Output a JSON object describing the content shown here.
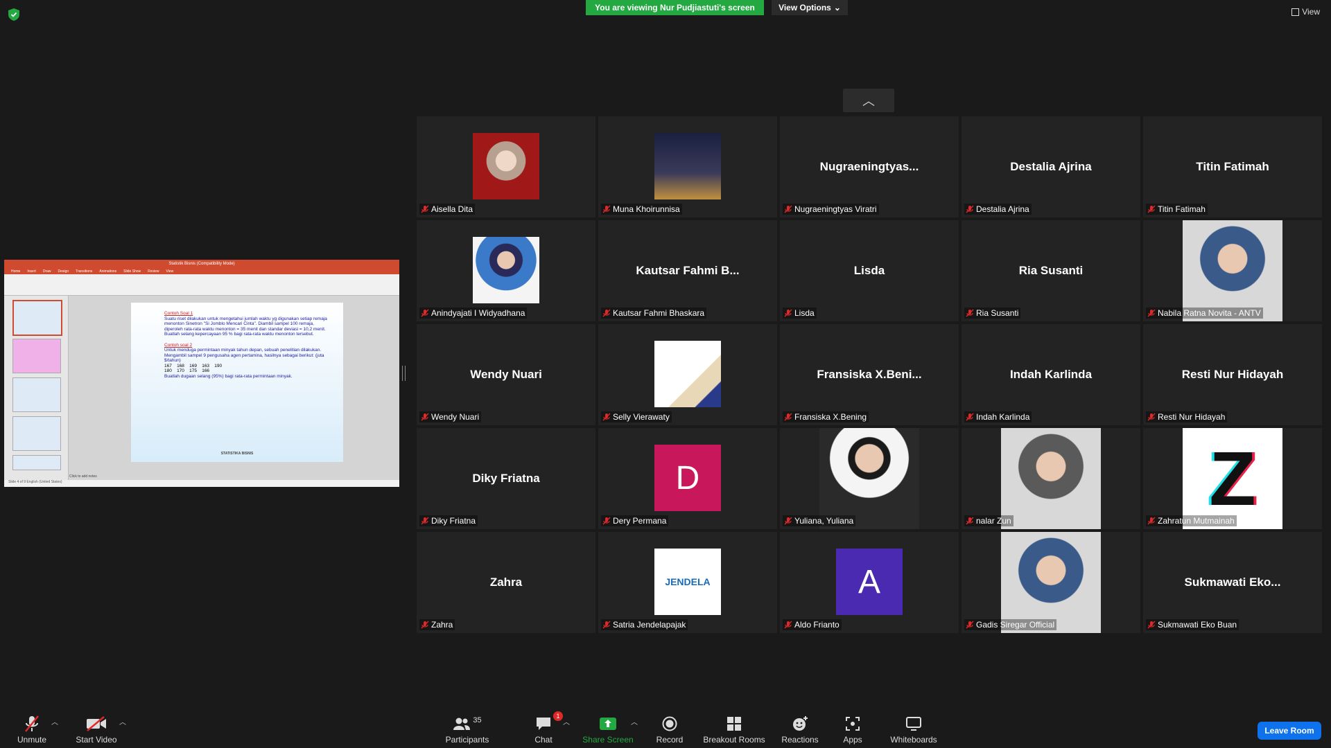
{
  "top": {
    "viewing_banner": "You are viewing Nur Pudjiastuti's screen",
    "view_options": "View Options",
    "view": "View"
  },
  "shared_screen": {
    "app_title": "Statistik Bisnis (Compatibility Mode)",
    "tabs": [
      "Home",
      "Insert",
      "Draw",
      "Design",
      "Transitions",
      "Animations",
      "Slide Show",
      "Review",
      "View"
    ],
    "slide": {
      "heading1": "Contoh Soal 1",
      "para1": "Suatu riset dilakukan untuk mengetahui jumlah waktu yg digunakan setiap remaja menonton Sinetron \"Si Jomblo Mencari Cinta\". Diambil sampel 100 remaja, diperoleh rata-rata waktu menonton = 35 menit dan standar deviasi = 10,2 menit. Buatlah selang kepercayaan 95 % bagi rata-rata waktu menonton tersebut.",
      "heading2": "Contoh soal 2",
      "para2": "Untuk menduga permintaan minyak tahun depan, sebuah penelitian dilakukan. Mengambil sampel 9 pengusaha agen pertamina, hasilnya sebagai berikut: (juta $/tahun)",
      "row1": "167    168    169    163    190",
      "row2": "180    170    175    166",
      "para3": "Buatlah dugaan selang (95%) bagi rata-rata permintaan minyak.",
      "footer": "STATISTIKA BISNIS"
    },
    "notes": "Click to add notes",
    "status": "Slide 4 of 9   English (United States)"
  },
  "participants": [
    {
      "name": "Aisella Dita",
      "display": "",
      "avatar": "photo"
    },
    {
      "name": "Muna Khoirunnisa",
      "display": "",
      "avatar": "photo"
    },
    {
      "name": "Nugraeningtyas Viratri",
      "display": "Nugraeningtyas...",
      "avatar": ""
    },
    {
      "name": "Destalia Ajrina",
      "display": "Destalia Ajrina",
      "avatar": ""
    },
    {
      "name": "Titin Fatimah",
      "display": "Titin Fatimah",
      "avatar": ""
    },
    {
      "name": "Anindyajati I Widyadhana",
      "display": "",
      "avatar": "photo"
    },
    {
      "name": "Kautsar Fahmi Bhaskara",
      "display": "Kautsar  Fahmi  B...",
      "avatar": ""
    },
    {
      "name": "Lisda",
      "display": "Lisda",
      "avatar": ""
    },
    {
      "name": "Ria Susanti",
      "display": "Ria Susanti",
      "avatar": ""
    },
    {
      "name": "Nabila Ratna Novita - ANTV",
      "display": "",
      "avatar": "photo"
    },
    {
      "name": "Wendy Nuari",
      "display": "Wendy Nuari",
      "avatar": ""
    },
    {
      "name": "Selly Vierawaty",
      "display": "",
      "avatar": "document"
    },
    {
      "name": "Fransiska X.Bening",
      "display": "Fransiska  X.Beni...",
      "avatar": ""
    },
    {
      "name": "Indah Karlinda",
      "display": "Indah Karlinda",
      "avatar": ""
    },
    {
      "name": "Resti Nur Hidayah",
      "display": "Resti Nur Hidayah",
      "avatar": ""
    },
    {
      "name": "Diky Friatna",
      "display": "Diky Friatna",
      "avatar": ""
    },
    {
      "name": "Dery Permana",
      "display": "",
      "avatar": "D"
    },
    {
      "name": "Yuliana, Yuliana",
      "display": "",
      "avatar": "photo"
    },
    {
      "name": "nalar Zun",
      "display": "",
      "avatar": "photo"
    },
    {
      "name": "Zahratun Mutmainah",
      "display": "",
      "avatar": "Z"
    },
    {
      "name": "Zahra",
      "display": "Zahra",
      "avatar": ""
    },
    {
      "name": "Satria Jendelapajak",
      "display": "",
      "avatar": "JENDELA"
    },
    {
      "name": "Aldo Frianto",
      "display": "",
      "avatar": "A"
    },
    {
      "name": "Gadis Siregar Official",
      "display": "",
      "avatar": "photo"
    },
    {
      "name": "Sukmawati Eko Buan",
      "display": "Sukmawati  Eko...",
      "avatar": ""
    }
  ],
  "toolbar": {
    "unmute": "Unmute",
    "start_video": "Start Video",
    "participants": "Participants",
    "participants_count": "35",
    "chat": "Chat",
    "chat_badge": "1",
    "share_screen": "Share Screen",
    "record": "Record",
    "breakout_rooms": "Breakout Rooms",
    "reactions": "Reactions",
    "apps": "Apps",
    "whiteboards": "Whiteboards",
    "leave_room": "Leave Room"
  },
  "colors": {
    "banner_green": "#23a842",
    "leave_blue": "#0e72ed",
    "mic_red": "#e02828",
    "tile_bg": "#232323"
  }
}
